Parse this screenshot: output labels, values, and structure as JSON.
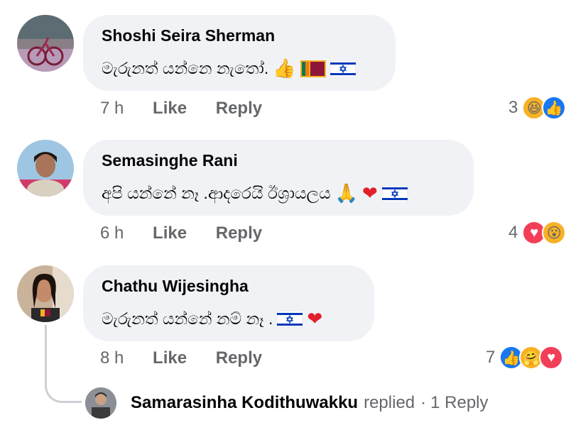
{
  "comments": [
    {
      "author": "Shoshi Seira Sherman",
      "text": "මැරුනත් යන්නෙ නැතෝ.",
      "emojis": [
        "thumbs-up",
        "sri-lanka-flag",
        "israel-flag"
      ],
      "time": "7 h",
      "like": "Like",
      "reply": "Reply",
      "reaction_count": "3",
      "reactions": [
        "haha",
        "like"
      ]
    },
    {
      "author": "Semasinghe Rani",
      "text": "අපි යන්නේ නෑ .ආදරෙයි ඊශ්‍රායලය",
      "emojis": [
        "folded-hands",
        "red-heart",
        "israel-flag"
      ],
      "time": "6 h",
      "like": "Like",
      "reply": "Reply",
      "reaction_count": "4",
      "reactions": [
        "love",
        "wow"
      ]
    },
    {
      "author": "Chathu Wijesingha",
      "text": "මැරුනත් යන්නේ නම් නෑ .",
      "emojis": [
        "israel-flag",
        "red-heart"
      ],
      "time": "8 h",
      "like": "Like",
      "reply": "Reply",
      "reaction_count": "7",
      "reactions": [
        "like",
        "care",
        "love"
      ]
    }
  ],
  "replies": {
    "name": "Samarasinha Kodithuwakku",
    "verb": "replied",
    "separator": "·",
    "count": "1 Reply"
  },
  "colors": {
    "bubble": "#f0f2f5",
    "meta": "#65676b",
    "like_blue": "#1877f2",
    "love_red": "#f33e58",
    "yellow": "#f7b125"
  }
}
